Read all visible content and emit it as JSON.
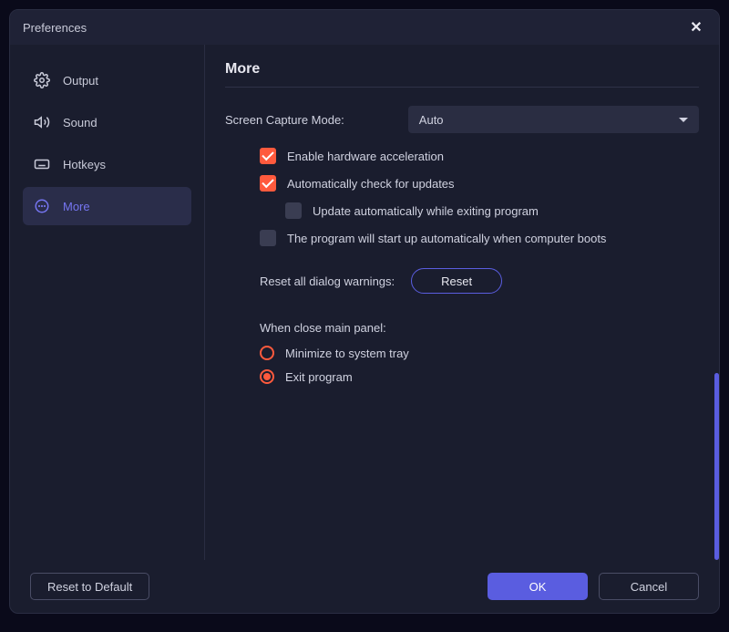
{
  "window": {
    "title": "Preferences"
  },
  "sidebar": {
    "items": [
      {
        "label": "Output"
      },
      {
        "label": "Sound"
      },
      {
        "label": "Hotkeys"
      },
      {
        "label": "More"
      }
    ]
  },
  "page": {
    "title": "More",
    "screen_capture_label": "Screen Capture Mode:",
    "screen_capture_value": "Auto",
    "checks": {
      "hw_accel": "Enable hardware acceleration",
      "auto_update": "Automatically check for updates",
      "update_on_exit": "Update automatically while exiting program",
      "startup": "The program will start up automatically when computer boots"
    },
    "reset_label": "Reset all dialog warnings:",
    "reset_button": "Reset",
    "close_panel_label": "When close main panel:",
    "radios": {
      "minimize": "Minimize to system tray",
      "exit": "Exit program"
    }
  },
  "footer": {
    "reset_default": "Reset to Default",
    "ok": "OK",
    "cancel": "Cancel"
  }
}
